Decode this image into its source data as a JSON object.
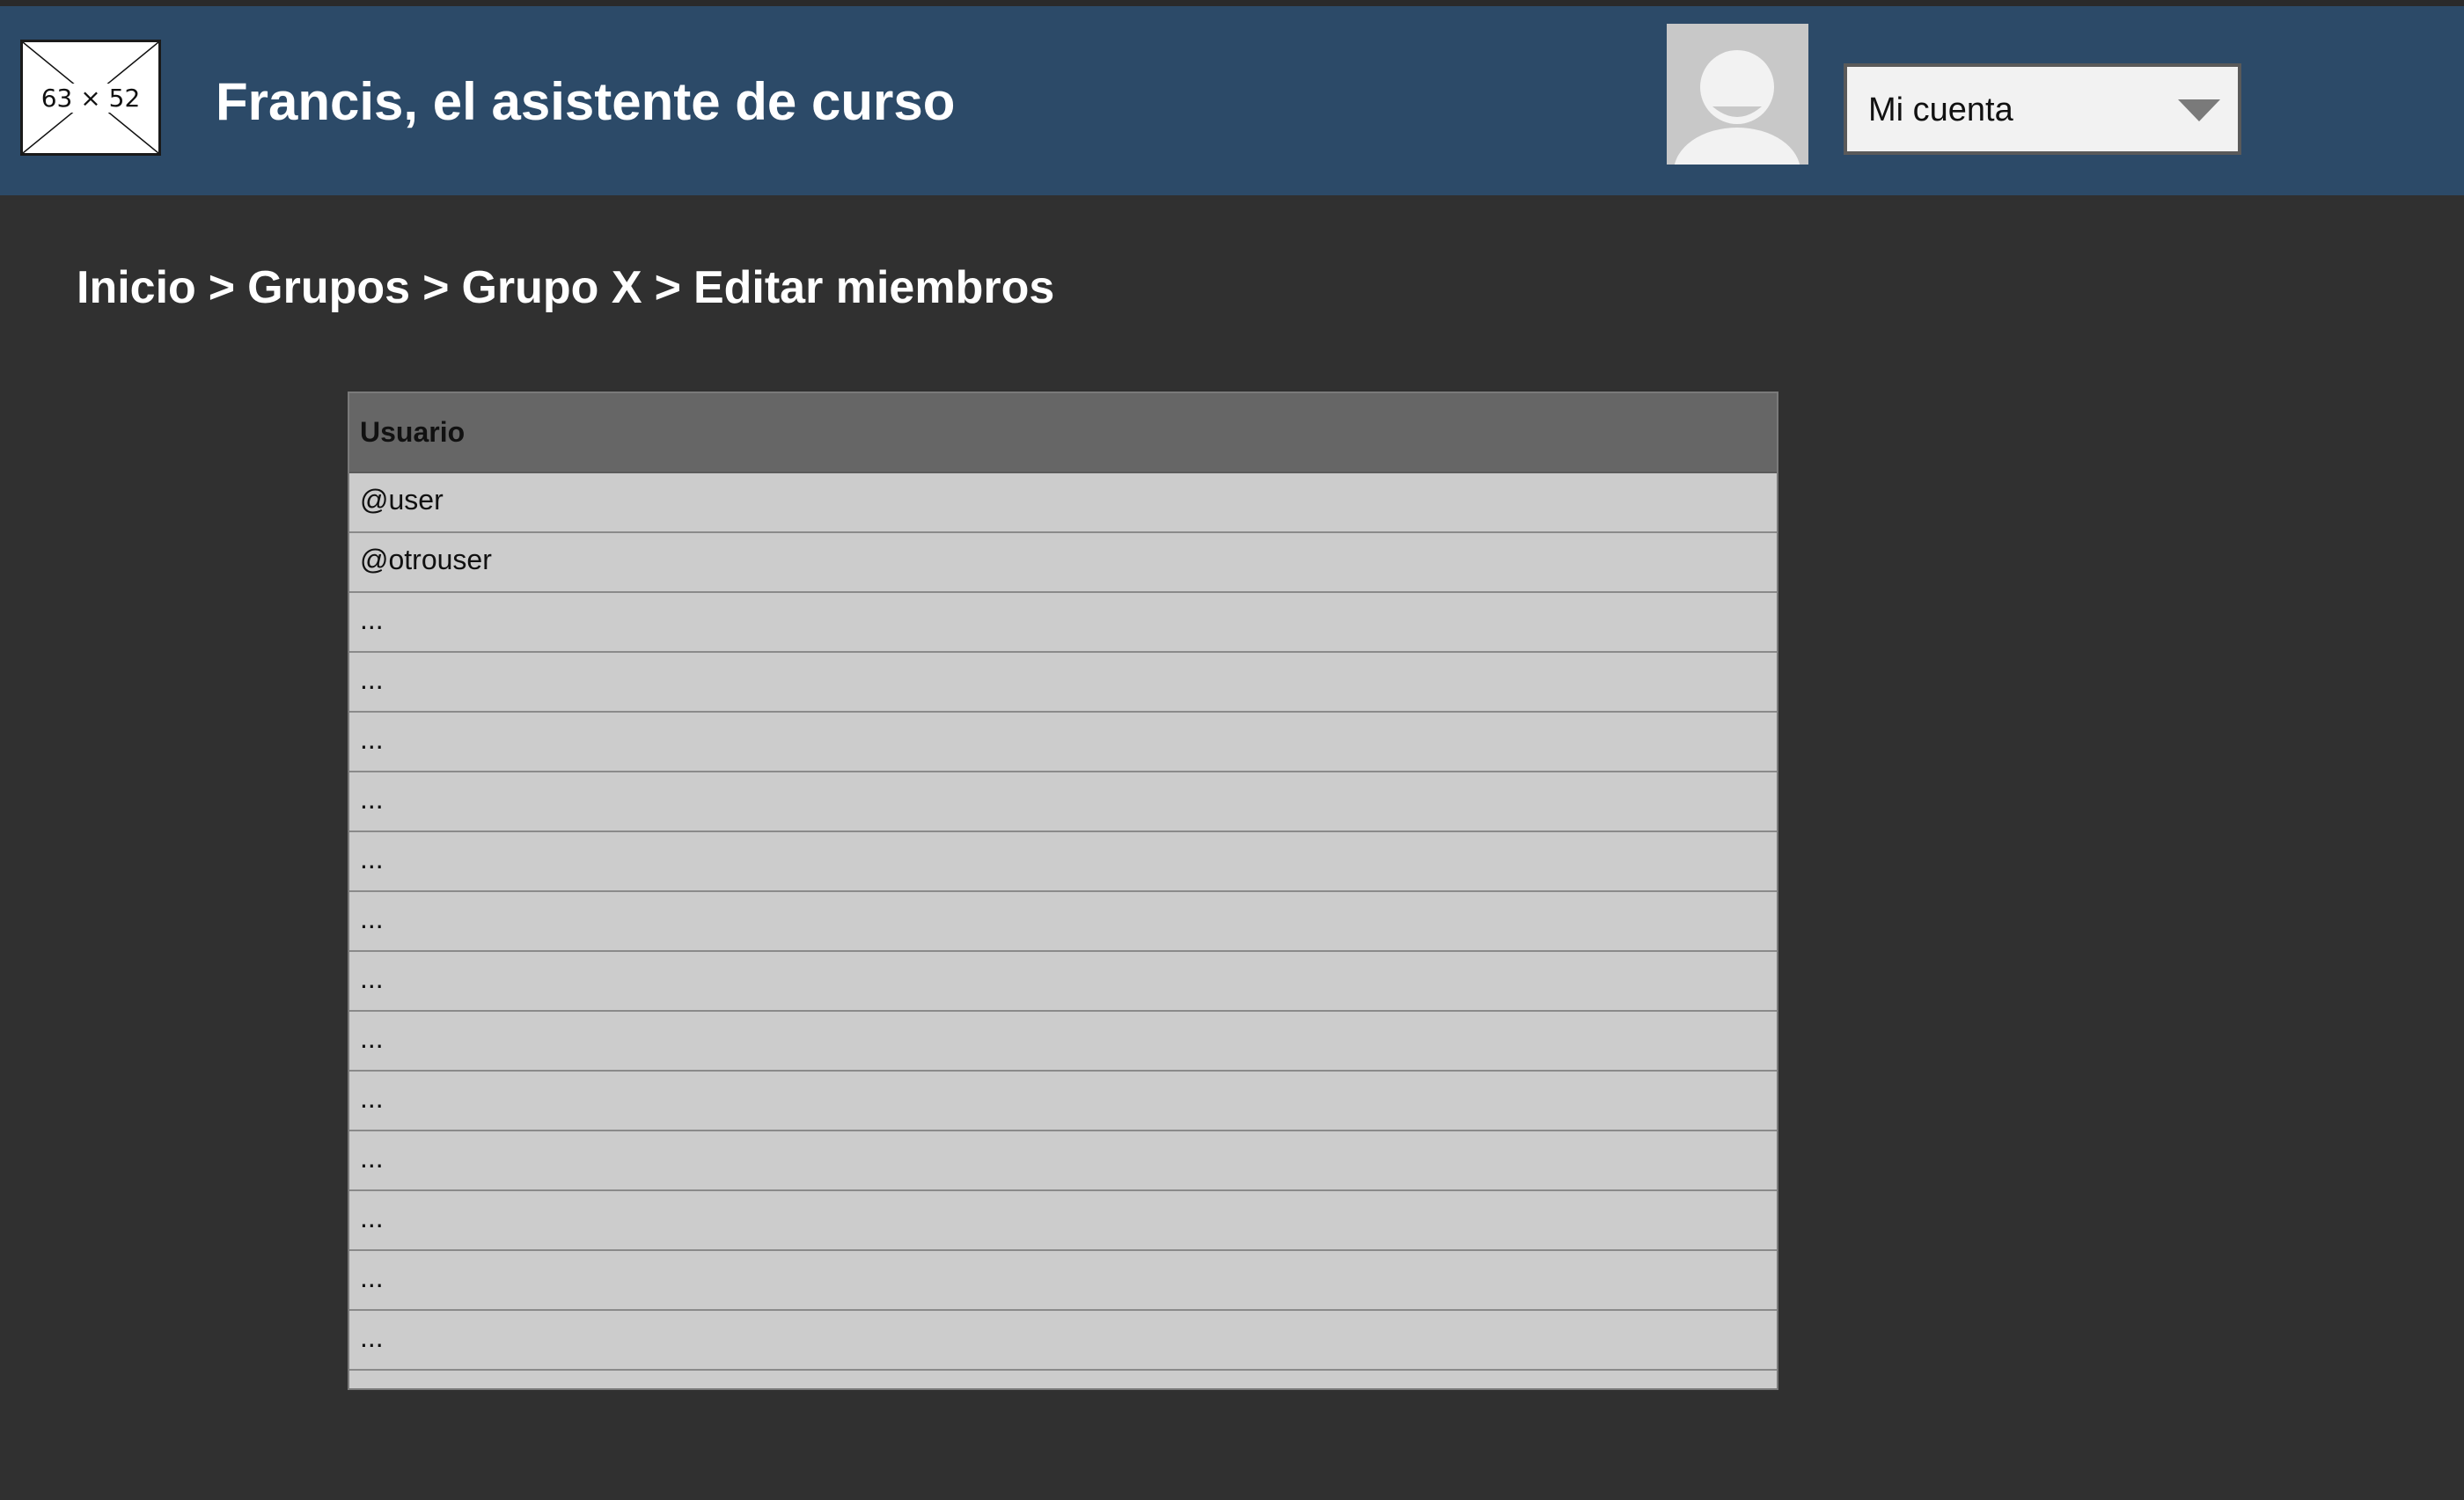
{
  "header": {
    "logo_placeholder": "63 × 52",
    "title": "Francis, el asistente de curso",
    "account_menu": "Mi cuenta"
  },
  "breadcrumb": {
    "items": [
      "Inicio",
      "Grupos",
      "Grupo X",
      "Editar miembros"
    ],
    "separator": ">"
  },
  "members_table": {
    "header": "Usuario",
    "rows": [
      "@user",
      "@otrouser",
      "...",
      "...",
      "...",
      "...",
      "...",
      "...",
      "...",
      "...",
      "...",
      "...",
      "...",
      "...",
      "...",
      ""
    ]
  },
  "colors": {
    "header_bg": "#2c4a68",
    "page_bg": "#303030",
    "table_header_bg": "#666666",
    "table_row_bg": "#cccccc"
  },
  "icons": {
    "logo": "placeholder-image-icon",
    "avatar": "user-avatar-icon",
    "dropdown": "chevron-down-icon"
  }
}
